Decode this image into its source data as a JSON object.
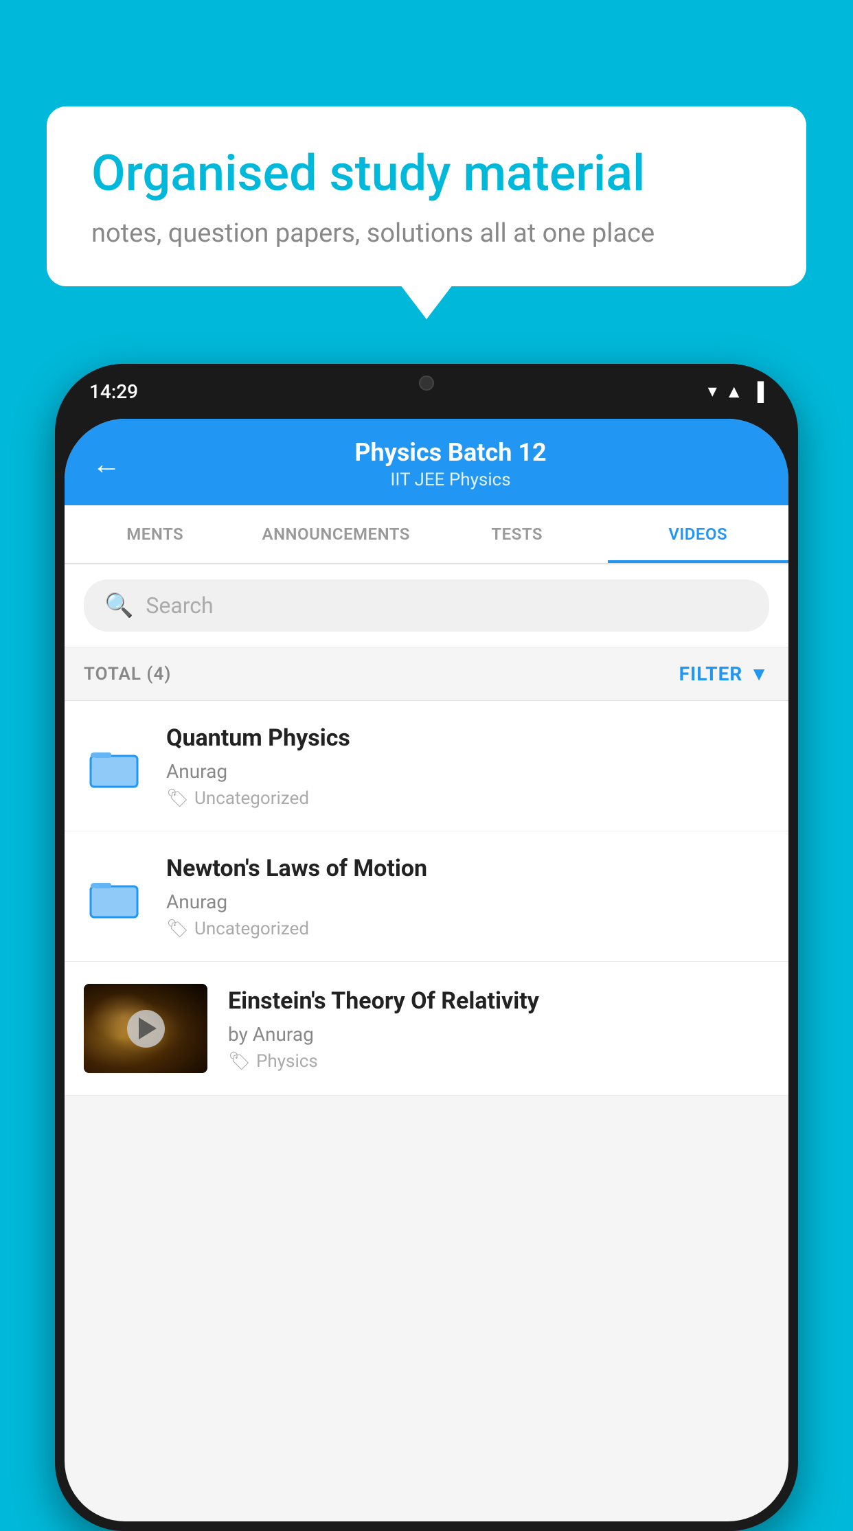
{
  "page": {
    "background_color": "#00B8D9"
  },
  "speech_bubble": {
    "title": "Organised study material",
    "subtitle": "notes, question papers, solutions all at one place"
  },
  "phone": {
    "status_bar": {
      "time": "14:29",
      "wifi": "▾",
      "signal": "◂",
      "battery": "▐"
    },
    "app_bar": {
      "back_label": "←",
      "title": "Physics Batch 12",
      "subtitle": "IIT JEE   Physics"
    },
    "tabs": [
      {
        "label": "MENTS",
        "active": false
      },
      {
        "label": "ANNOUNCEMENTS",
        "active": false
      },
      {
        "label": "TESTS",
        "active": false
      },
      {
        "label": "VIDEOS",
        "active": true
      }
    ],
    "search": {
      "placeholder": "Search"
    },
    "filter_row": {
      "total_label": "TOTAL (4)",
      "filter_label": "FILTER"
    },
    "videos": [
      {
        "title": "Quantum Physics",
        "author": "Anurag",
        "tag": "Uncategorized",
        "type": "folder"
      },
      {
        "title": "Newton's Laws of Motion",
        "author": "Anurag",
        "tag": "Uncategorized",
        "type": "folder"
      },
      {
        "title": "Einstein's Theory Of Relativity",
        "author": "by Anurag",
        "tag": "Physics",
        "type": "video"
      }
    ]
  }
}
